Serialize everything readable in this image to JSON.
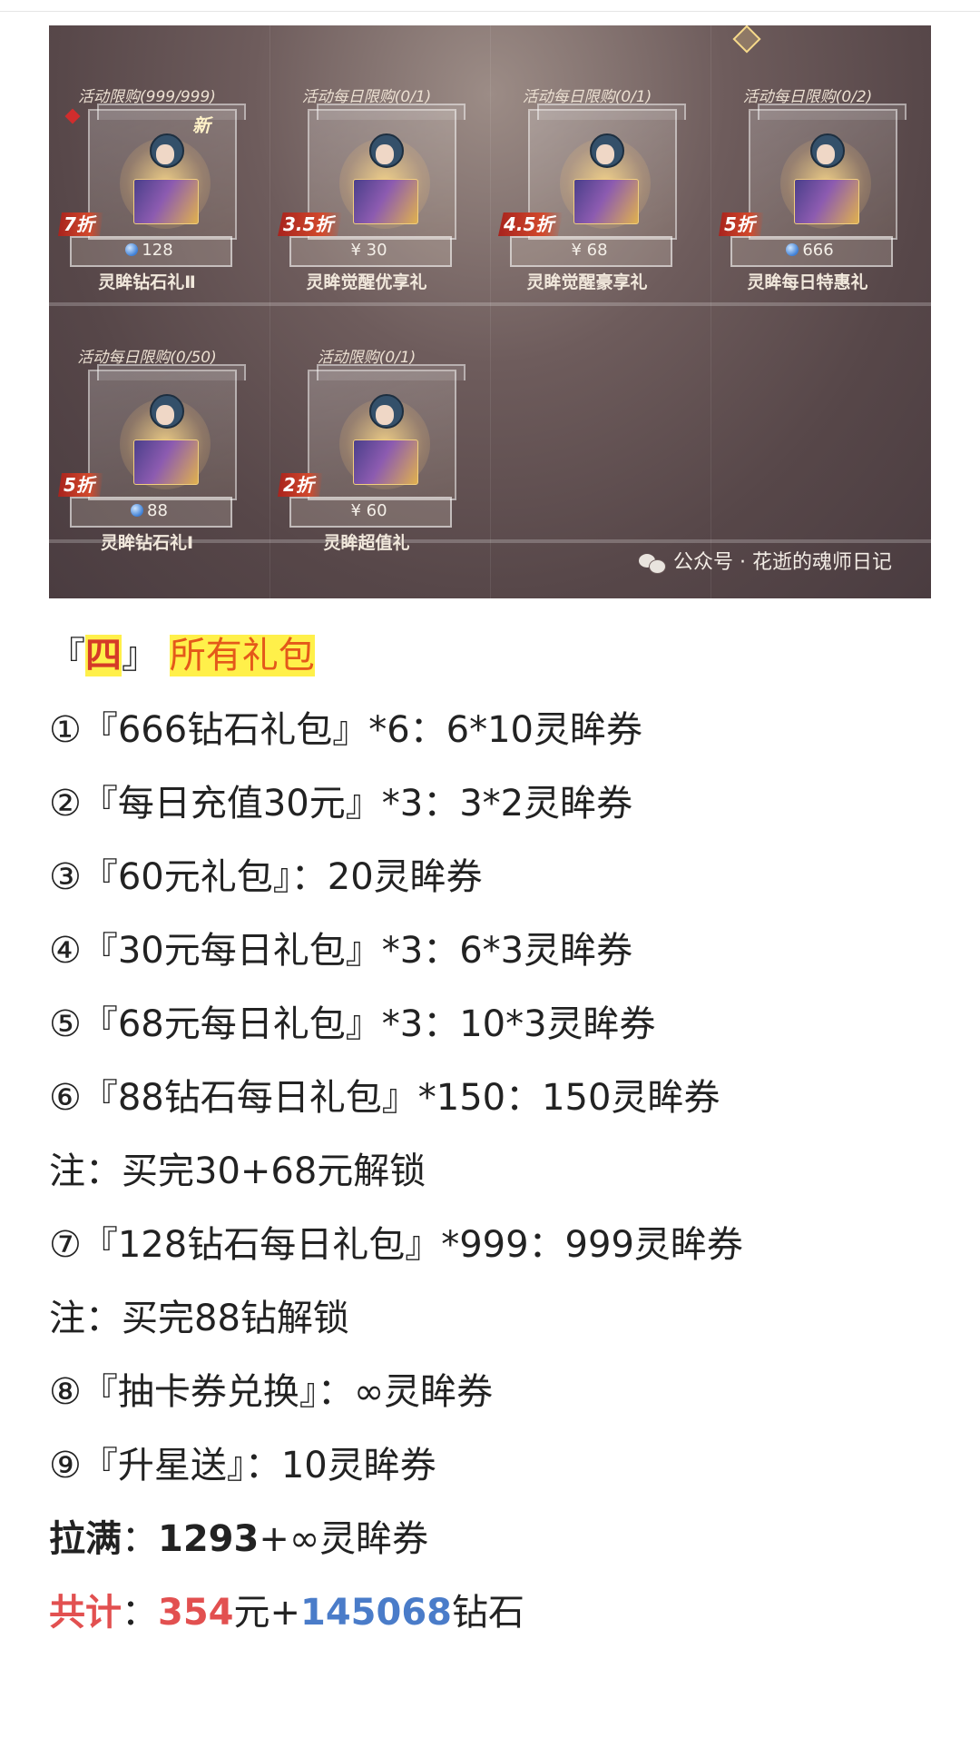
{
  "game_screenshot": {
    "row1": [
      {
        "limit": "活动限购(999/999)",
        "discount": "7折",
        "price": "128",
        "price_type": "diamond",
        "name": "灵眸钻石礼Ⅱ",
        "is_new": true,
        "new_label": "新"
      },
      {
        "limit": "活动每日限购(0/1)",
        "discount": "3.5折",
        "price": "¥ 30",
        "price_type": "cash",
        "name": "灵眸觉醒优享礼",
        "is_new": false
      },
      {
        "limit": "活动每日限购(0/1)",
        "discount": "4.5折",
        "price": "¥ 68",
        "price_type": "cash",
        "name": "灵眸觉醒豪享礼",
        "is_new": false
      },
      {
        "limit": "活动每日限购(0/2)",
        "discount": "5折",
        "price": "666",
        "price_type": "diamond",
        "name": "灵眸每日特惠礼",
        "is_new": false
      }
    ],
    "row2": [
      {
        "limit": "活动每日限购(0/50)",
        "discount": "5折",
        "price": "88",
        "price_type": "diamond",
        "name": "灵眸钻石礼Ⅰ",
        "is_new": false
      },
      {
        "limit": "活动限购(0/1)",
        "discount": "2折",
        "price": "¥ 60",
        "price_type": "cash",
        "name": "灵眸超值礼",
        "is_new": false
      }
    ],
    "watermark": "公众号 · 花逝的魂师日记"
  },
  "section": {
    "bracket_open": "『",
    "number": "四",
    "bracket_close": "』",
    "title": "所有礼包"
  },
  "items": [
    "①『666钻石礼包』*6：6*10灵眸券",
    "②『每日充值30元』*3：3*2灵眸券",
    "③『60元礼包』：20灵眸券",
    "④『30元每日礼包』*3：6*3灵眸券",
    "⑤『68元每日礼包』*3：10*3灵眸券",
    "⑥『88钻石每日礼包』*150：150灵眸券",
    "注：买完30+68元解锁",
    "⑦『128钻石每日礼包』*999：999灵眸券",
    "注：买完88钻解锁",
    "⑧『抽卡券兑换』：∞灵眸券",
    "⑨『升星送』：10灵眸券"
  ],
  "summary": {
    "max_label": "拉满",
    "colon": "：",
    "max_value": "1293",
    "max_rest": "+∞灵眸券",
    "total_label": "共计",
    "total_cash": "354",
    "total_mid": "元+",
    "total_diamond": "145068",
    "total_suffix": "钻石"
  },
  "colors": {
    "highlight": "#fff04a",
    "title_red": "#d53b28",
    "title_orange": "#e4591a",
    "total_red": "#e25050",
    "total_blue": "#4a7cc9"
  },
  "icons": [
    "diamond-currency-icon",
    "wechat-icon",
    "new-badge-icon"
  ]
}
